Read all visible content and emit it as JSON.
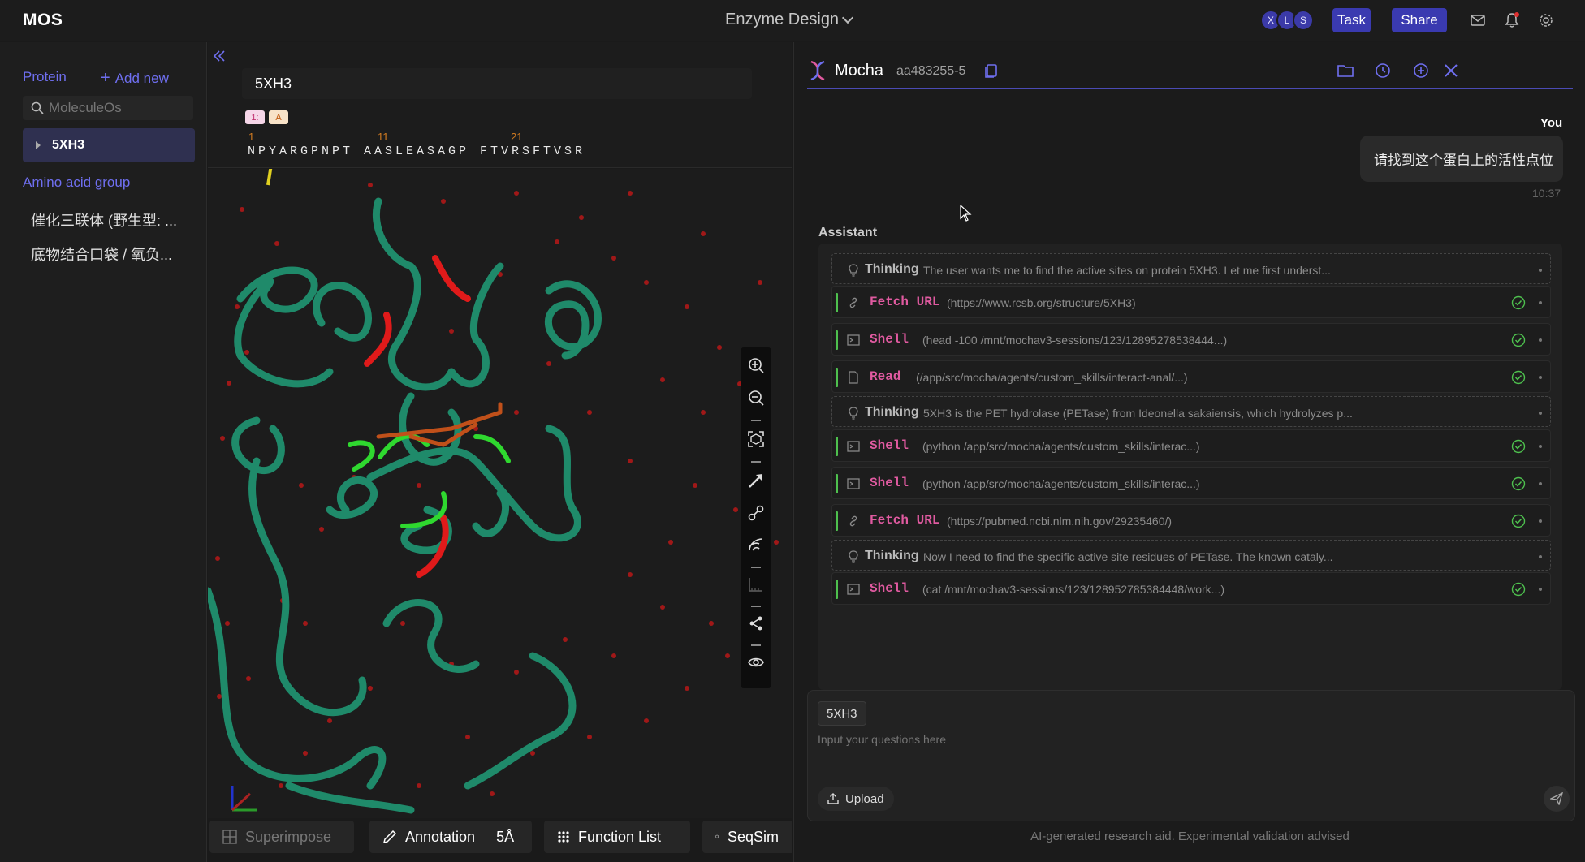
{
  "app": {
    "brand": "MOS",
    "project_title": "Enzyme Design"
  },
  "topbar": {
    "avatars": [
      "X",
      "L",
      "S"
    ],
    "task_label": "Task",
    "share_label": "Share",
    "icons": [
      "mail-icon",
      "bell-icon",
      "gear-icon"
    ]
  },
  "left": {
    "protein_header": "Protein",
    "add_new": "Add new",
    "search_placeholder": "MoleculeOs",
    "items": [
      {
        "label": "5XH3"
      }
    ],
    "amino_group_header": "Amino acid group",
    "groups": [
      "催化三联体 (野生型: ...",
      "底物结合口袋 / 氧负..."
    ]
  },
  "sequence": {
    "title": "5XH3",
    "chips": [
      "1:",
      "A"
    ],
    "numbers": [
      "1",
      "11",
      "21"
    ],
    "residues": "NPYARGPNPT AASLEASAGP FTVRSFTVSR"
  },
  "bottom_toolbar": {
    "superimpose": "Superimpose",
    "annotation": "Annotation",
    "annotation_value": "5Å",
    "function_list": "Function List",
    "seqsim": "SeqSim"
  },
  "chat": {
    "name": "Mocha",
    "session_id": "aa483255-5",
    "you_label": "You",
    "user_message": "请找到这个蛋白上的活性点位",
    "user_time": "10:37",
    "assistant_label": "Assistant",
    "steps": [
      {
        "kind": "think",
        "name": "Thinking",
        "arg": "The user wants me to find the active sites on protein 5XH3. Let me first underst..."
      },
      {
        "kind": "tool",
        "icon": "link-icon",
        "name": "Fetch URL",
        "arg": "(https://www.rcsb.org/structure/5XH3)"
      },
      {
        "kind": "tool",
        "icon": "terminal-icon",
        "name": "Shell",
        "arg": "(head -100 /mnt/mochav3-sessions/123/12895278538444...)"
      },
      {
        "kind": "tool",
        "icon": "file-icon",
        "name": "Read",
        "arg": "(/app/src/mocha/agents/custom_skills/interact-anal/...)"
      },
      {
        "kind": "think",
        "name": "Thinking",
        "arg": "5XH3 is the PET hydrolase (PETase) from Ideonella sakaiensis, which hydrolyzes p..."
      },
      {
        "kind": "tool",
        "icon": "terminal-icon",
        "name": "Shell",
        "arg": "(python /app/src/mocha/agents/custom_skills/interac...)"
      },
      {
        "kind": "tool",
        "icon": "terminal-icon",
        "name": "Shell",
        "arg": "(python /app/src/mocha/agents/custom_skills/interac...)"
      },
      {
        "kind": "tool",
        "icon": "link-icon",
        "name": "Fetch URL",
        "arg": "(https://pubmed.ncbi.nlm.nih.gov/29235460/)"
      },
      {
        "kind": "think",
        "name": "Thinking",
        "arg": "Now I need to find the specific active site residues of PETase. The known cataly..."
      },
      {
        "kind": "tool",
        "icon": "terminal-icon",
        "name": "Shell",
        "arg": "(cat /mnt/mochav3-sessions/123/128952785384448/work...)"
      }
    ],
    "context_chip": "5XH3",
    "input_placeholder": "Input your questions here",
    "upload_label": "Upload",
    "disclaimer": "AI-generated research aid. Experimental validation advised"
  },
  "colors": {
    "accent": "#3a3ab0",
    "link": "#6f6ff0",
    "tool_name": "#e05aa0",
    "success": "#4ec04e",
    "ribbon": "#1f8a6a"
  }
}
